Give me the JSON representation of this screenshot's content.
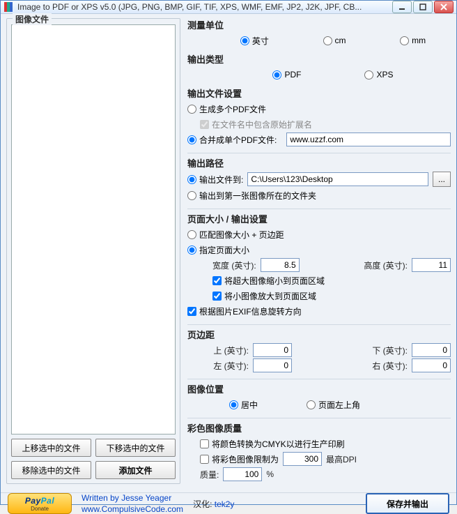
{
  "window": {
    "title": "Image to PDF or XPS  v5.0   (JPG, PNG, BMP, GIF, TIF, XPS, WMF, EMF, JP2, J2K, JPF, CB..."
  },
  "left": {
    "legend": "图像文件",
    "buttons": {
      "move_up": "上移选中的文件",
      "move_down": "下移选中的文件",
      "remove": "移除选中的文件",
      "add": "添加文件"
    }
  },
  "unit": {
    "heading": "测量单位",
    "options": [
      "英寸",
      "cm",
      "mm"
    ],
    "selected": "英寸"
  },
  "output_type": {
    "heading": "输出类型",
    "options": [
      "PDF",
      "XPS"
    ],
    "selected": "PDF"
  },
  "output_file": {
    "heading": "输出文件设置",
    "multi": "生成多个PDF文件",
    "include_ext": "在文件名中包含原始扩展名",
    "single": "合并成单个PDF文件:",
    "single_name": "www.uzzf.com",
    "selected": "single"
  },
  "output_path": {
    "heading": "输出路径",
    "to_folder": "输出文件到:",
    "folder": "C:\\Users\\123\\Desktop",
    "browse": "...",
    "same_folder": "输出到第一张图像所在的文件夹",
    "selected": "to_folder"
  },
  "page": {
    "heading": "页面大小 / 输出设置",
    "match_image": "匹配图像大小 + 页边距",
    "specify": "指定页面大小",
    "selected": "specify",
    "width_label": "宽度 (英寸):",
    "width": "8.5",
    "height_label": "高度 (英寸):",
    "height": "11",
    "shrink": "将超大图像缩小到页面区域",
    "enlarge": "将小图像放大到页面区域",
    "exif": "根据图片EXIF信息旋转方向",
    "shrink_checked": true,
    "enlarge_checked": true,
    "exif_checked": true
  },
  "margins": {
    "heading": "页边距",
    "top_label": "上 (英寸):",
    "top": "0",
    "bottom_label": "下 (英寸):",
    "bottom": "0",
    "left_label": "左 (英寸):",
    "left": "0",
    "right_label": "右 (英寸):",
    "right": "0"
  },
  "position": {
    "heading": "图像位置",
    "center": "居中",
    "topleft": "页面左上角",
    "selected": "center"
  },
  "quality": {
    "heading": "彩色图像质量",
    "cmyk": "将颜色转换为CMYK以进行生产印刷",
    "cmyk_checked": false,
    "limit": "将彩色图像限制为",
    "limit_checked": false,
    "max_dpi": "300",
    "max_dpi_label": "最高DPI",
    "qlabel": "质量:",
    "q": "100",
    "pct": "%"
  },
  "footer": {
    "donate": "Donate",
    "written_by": "Written by Jesse Yeager",
    "website": "www.CompulsiveCode.com",
    "translated_label": "汉化:",
    "translator": "tek2y",
    "save": "保存并输出"
  }
}
